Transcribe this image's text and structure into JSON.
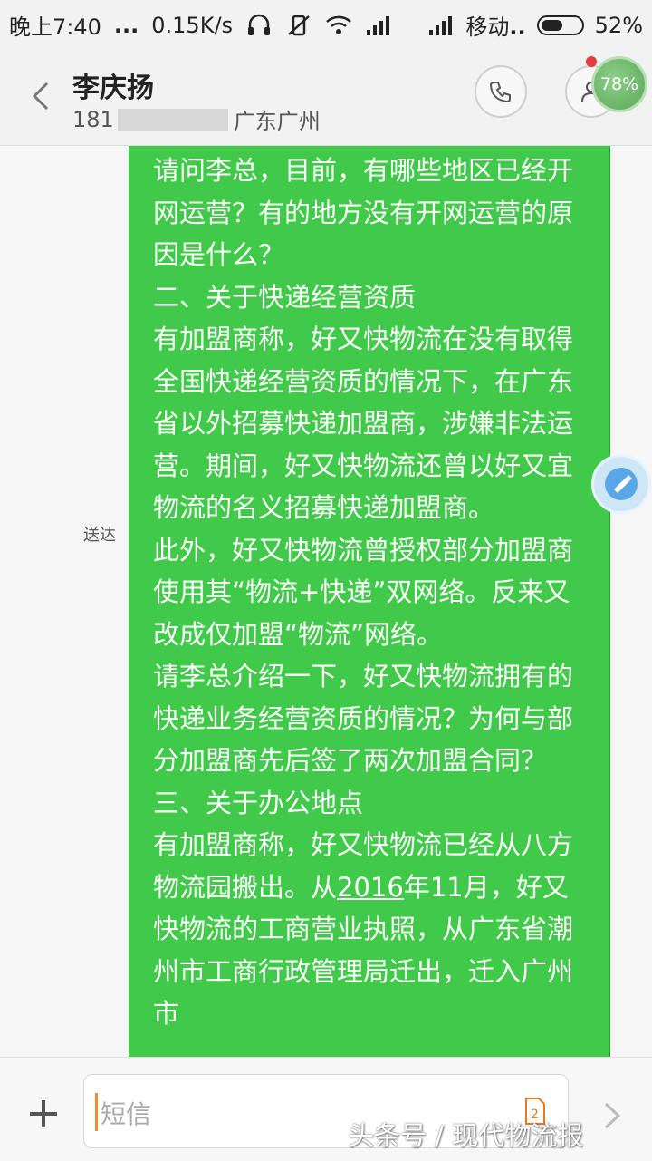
{
  "status_bar": {
    "time": "晚上7:40",
    "dots": "...",
    "speed": "0.15K/s",
    "carrier": "移动",
    "carrier_dots": "..",
    "battery": "52%",
    "battery_level": 0.52
  },
  "header": {
    "contact_name": "李庆扬",
    "phone_prefix": "181",
    "location": "广东广州"
  },
  "perf_badge": "78%",
  "message": {
    "status": "送达",
    "paragraphs": [
      "请问李总，目前，有哪些地区已经开网运营？有的地方没有开网运营的原因是什么？",
      "",
      "二、关于快递经营资质",
      "有加盟商称，好又快物流在没有取得全国快递经营资质的情况下，在广东省以外招募快递加盟商，涉嫌非法运营。期间，好又快物流还曾以好又宜物流的名义招募快递加盟商。",
      "此外，好又快物流曾授权部分加盟商使用其“物流+快递”双网络。反来又改成仅加盟“物流”网络。",
      "请李总介绍一下，好又快物流拥有的快递业务经营资质的情况？为何与部分加盟商先后签了两次加盟合同？",
      "",
      "三、关于办公地点"
    ],
    "p9_part1": "有加盟商称，好又快物流已经从八方物流园搬出。从",
    "p9_underlined": "2016",
    "p9_part2": "年11月，好又快物流的工商营业执照，从广东省潮州市工商行政管理局迁出，迁入广州市"
  },
  "input": {
    "placeholder": "短信"
  },
  "watermark": "头条号 / 现代物流报",
  "colors": {
    "bubble": "#41c94a",
    "accent_caret": "#f08a2c"
  }
}
